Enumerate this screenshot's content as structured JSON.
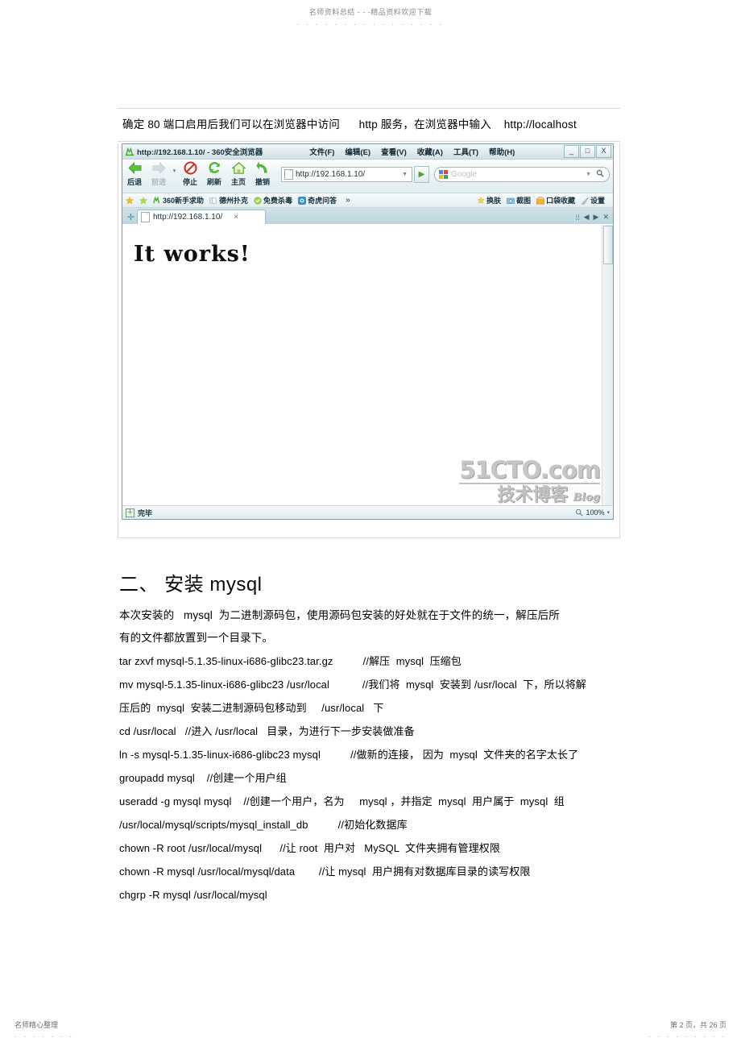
{
  "page_header": {
    "watermark": "名师资料总结 - - -精品资料欢迎下载",
    "dots": ". . . . . . . . . . . . . . . ."
  },
  "intro": {
    "line": "确定 80 端口启用后我们可以在浏览器中访问      http 服务，在浏览器中输入    http://localhost"
  },
  "browser": {
    "window_title": "http://192.168.1.10/ - 360安全浏览器",
    "menus": [
      "文件(F)",
      "编辑(E)",
      "查看(V)",
      "收藏(A)",
      "工具(T)",
      "帮助(H)"
    ],
    "window_buttons": {
      "minimize": "_",
      "maximize": "□",
      "close": "X"
    },
    "nav_buttons": [
      {
        "label": "后退",
        "icon": "back-arrow-icon",
        "enabled": true
      },
      {
        "label": "前进",
        "icon": "forward-arrow-icon",
        "enabled": false
      },
      {
        "label": "停止",
        "icon": "stop-icon",
        "enabled": true
      },
      {
        "label": "刷新",
        "icon": "refresh-icon",
        "enabled": true
      },
      {
        "label": "主页",
        "icon": "home-icon",
        "enabled": true
      },
      {
        "label": "撤销",
        "icon": "undo-icon",
        "enabled": true
      }
    ],
    "address_bar": {
      "value": "http://192.168.1.10/",
      "dropdown": "▼",
      "go": "▶"
    },
    "search_box": {
      "placeholder": "Google",
      "dropdown": "▼",
      "magnifier": "🔍"
    },
    "bookmarks": [
      {
        "label": "",
        "icon": "star-gold-icon"
      },
      {
        "label": "",
        "icon": "star-green-icon"
      },
      {
        "label": "360新手求助",
        "icon": "360-icon"
      },
      {
        "label": "德州扑克",
        "icon": "poker-icon"
      },
      {
        "label": "免费杀毒",
        "icon": "antivirus-icon"
      },
      {
        "label": "奇虎问答",
        "icon": "qihoo-icon"
      }
    ],
    "bookmarks_overflow": "»",
    "bookmarks_right": [
      {
        "label": "换肤",
        "icon": "skin-icon"
      },
      {
        "label": "截图",
        "icon": "screenshot-icon"
      },
      {
        "label": "口袋收藏",
        "icon": "pocket-icon"
      },
      {
        "label": "设置",
        "icon": "settings-icon"
      }
    ],
    "tab": {
      "title": "http://192.168.1.10/",
      "close": "×",
      "new_tab": "✛"
    },
    "tab_controls": [
      "⁞⁞",
      "◀",
      "▶",
      "✕"
    ],
    "page_content": "It works!",
    "watermark": {
      "main": "51CTO.com",
      "sub": "技术博客",
      "blog": "Blog"
    },
    "status": {
      "text": "完毕",
      "icon": "page-done-icon",
      "zoom": "100%",
      "zoom_caret": "▾"
    }
  },
  "section": {
    "title": "二、 安装 mysql",
    "paragraph": "本次安装的   mysql  为二进制源码包，使用源码包安装的好处就在于文件的统一，解压后所\n有的文件都放置到一个目录下。",
    "commands": [
      "tar zxvf mysql-5.1.35-linux-i686-glibc23.tar.gz          //解压  mysql  压缩包",
      "mv mysql-5.1.35-linux-i686-glibc23 /usr/local           //我们将  mysql  安装到 /usr/local  下，所以将解\n压后的  mysql  安装二进制源码包移动到     /usr/local   下",
      "cd /usr/local   //进入 /usr/local   目录，为进行下一步安装做准备",
      "ln -s mysql-5.1.35-linux-i686-glibc23 mysql          //做新的连接， 因为  mysql  文件夹的名字太长了",
      "groupadd mysql    //创建一个用户组",
      "useradd -g mysql mysql    //创建一个用户，名为     mysql ，并指定  mysql  用户属于  mysql  组",
      "/usr/local/mysql/scripts/mysql_install_db          //初始化数据库",
      "chown -R root /usr/local/mysql      //让 root  用户对   MySQL  文件夹拥有管理权限",
      "chown -R mysql /usr/local/mysql/data        //让 mysql  用户拥有对数据库目录的读写权限",
      "chgrp -R mysql /usr/local/mysql"
    ]
  },
  "page_footer": {
    "left": "名师精心整理",
    "left_dots": ". . . . . . .",
    "right": "第 2 页，共 26 页",
    "right_dots": ". . . . . . . . ."
  }
}
